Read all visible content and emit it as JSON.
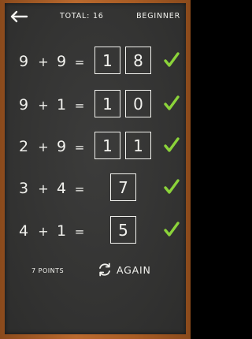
{
  "header": {
    "total_label": "TOTAL: 16",
    "level": "BEGINNER",
    "back_icon": "arrow-left-icon"
  },
  "problems": [
    {
      "a": "9",
      "op": "+",
      "b": "9",
      "eq": "=",
      "digits": [
        "1",
        "8"
      ],
      "correct": true
    },
    {
      "a": "9",
      "op": "+",
      "b": "1",
      "eq": "=",
      "digits": [
        "1",
        "0"
      ],
      "correct": true
    },
    {
      "a": "2",
      "op": "+",
      "b": "9",
      "eq": "=",
      "digits": [
        "1",
        "1"
      ],
      "correct": true
    },
    {
      "a": "3",
      "op": "+",
      "b": "4",
      "eq": "=",
      "digits": [
        "7"
      ],
      "correct": true
    },
    {
      "a": "4",
      "op": "+",
      "b": "1",
      "eq": "=",
      "digits": [
        "5"
      ],
      "correct": true
    }
  ],
  "footer": {
    "points": "7 POINTS",
    "again_label": "AGAIN",
    "again_icon": "refresh-icon"
  },
  "colors": {
    "chalk": "#f2f2ee",
    "check_green": "#8bd33a",
    "board": "#363635",
    "frame_wood": "#a85c24"
  }
}
